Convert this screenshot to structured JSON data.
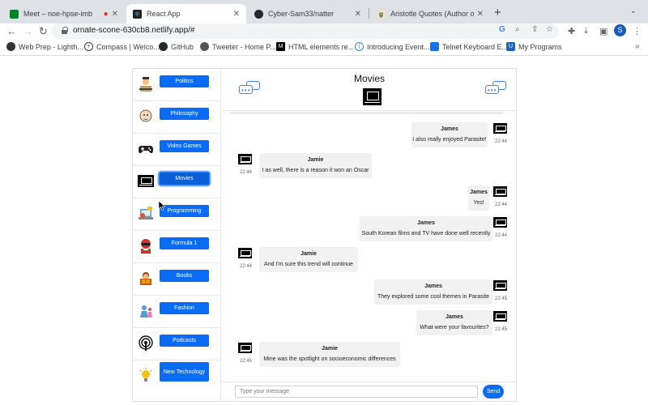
{
  "browser": {
    "tabs": [
      {
        "title": "Meet – noe-hpse-imb",
        "active": false
      },
      {
        "title": "React App",
        "active": true
      },
      {
        "title": "Cyber-Sam33/natter",
        "active": false
      },
      {
        "title": "Aristotle Quotes (Author of The",
        "active": false
      }
    ],
    "url": "ornate-scone-630cb8.netlify.app/#",
    "profile_initial": "S",
    "bookmarks": [
      "Web Prep - Lighth...",
      "Compass | Welco...",
      "GitHub",
      "Tweeter - Home P...",
      "HTML elements re...",
      "Introducing Event...",
      "Telnet Keyboard E...",
      "My Programs"
    ]
  },
  "app": {
    "accent_color": "#0a6cf5",
    "categories": [
      {
        "label": "Politics",
        "icon": "politician-icon"
      },
      {
        "label": "Philosophy",
        "icon": "philosopher-icon"
      },
      {
        "label": "Video Games",
        "icon": "gamepad-icon"
      },
      {
        "label": "Movies",
        "icon": "tv-icon",
        "selected": true
      },
      {
        "label": "Programming",
        "icon": "laptop-icon"
      },
      {
        "label": "Formula 1",
        "icon": "racer-icon"
      },
      {
        "label": "Books",
        "icon": "reader-icon"
      },
      {
        "label": "Fashion",
        "icon": "fashion-icon"
      },
      {
        "label": "Podcasts",
        "icon": "podcast-icon"
      },
      {
        "label": "New Technology",
        "icon": "idea-icon"
      }
    ],
    "chat": {
      "title": "Movies",
      "messages": [
        {
          "sender": "James",
          "text": "I also really enjoyed Parasite!",
          "time": "22:44",
          "side": "right"
        },
        {
          "sender": "Jamie",
          "text": "I as well, there is a reason it won an Oscar",
          "time": "22:44",
          "side": "left"
        },
        {
          "sender": "James",
          "text": "Yes!",
          "time": "22:44",
          "side": "right"
        },
        {
          "sender": "James",
          "text": "South Korean films and TV have done well recently",
          "time": "22:44",
          "side": "right"
        },
        {
          "sender": "Jamie",
          "text": "And I'm sure this trend will continue",
          "time": "22:44",
          "side": "left"
        },
        {
          "sender": "James",
          "text": "They explored some cool themes in Parasite",
          "time": "22:45",
          "side": "right"
        },
        {
          "sender": "James",
          "text": "What were your favourites?",
          "time": "22:45",
          "side": "right"
        },
        {
          "sender": "Jamie",
          "text": "Mine was the spotlight on socioeconomic differences",
          "time": "22:45",
          "side": "left"
        }
      ],
      "input_placeholder": "Type your message",
      "input_value": "",
      "send_label": "Send"
    }
  }
}
